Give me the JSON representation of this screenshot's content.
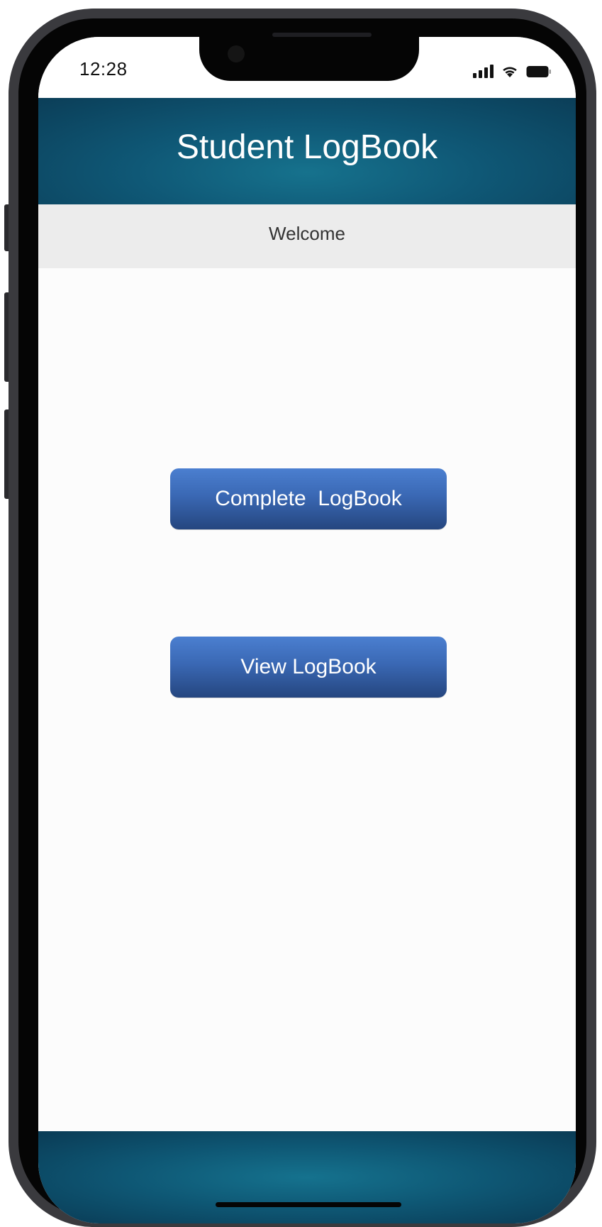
{
  "status_bar": {
    "time": "12:28"
  },
  "header": {
    "title": "Student LogBook"
  },
  "subheader": {
    "text": "Welcome"
  },
  "actions": {
    "complete_label": "Complete  LogBook",
    "view_label": "View LogBook"
  },
  "colors": {
    "header": "#0f5876",
    "subheader": "#ececec",
    "button": "#3a68b4"
  }
}
